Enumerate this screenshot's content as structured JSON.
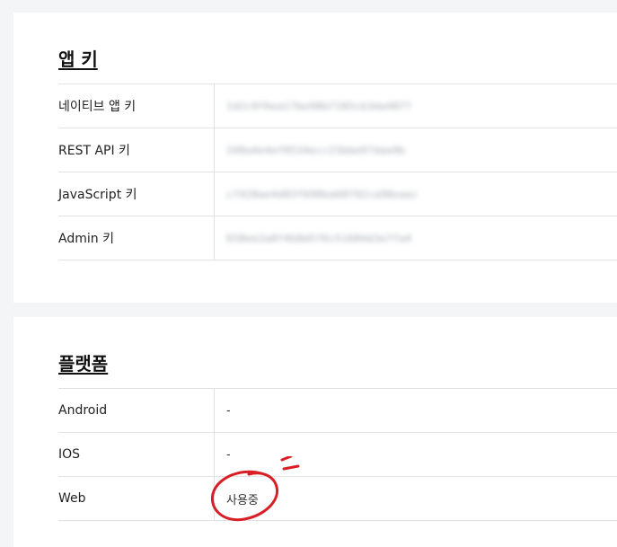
{
  "app_keys": {
    "title": "앱 키",
    "rows": [
      {
        "label": "네이티브 앱 키",
        "value": "1d2c9f6ea17be98b7185cb3da4877"
      },
      {
        "label": "REST API 키",
        "value": "348a4e4ef8534ecc23bbe97dae9b"
      },
      {
        "label": "JavaScript 키",
        "value": "c7428ae4d83f698ba68f92ca98eaac"
      },
      {
        "label": "Admin 키",
        "value": "658ee2a8f4b8d5f6c51684d3e7fa4"
      }
    ]
  },
  "platforms": {
    "title": "플랫폼",
    "rows": [
      {
        "label": "Android",
        "value": "-"
      },
      {
        "label": "IOS",
        "value": "-"
      },
      {
        "label": "Web",
        "value": "사용중"
      }
    ]
  },
  "annotation_color": "#d81f26"
}
